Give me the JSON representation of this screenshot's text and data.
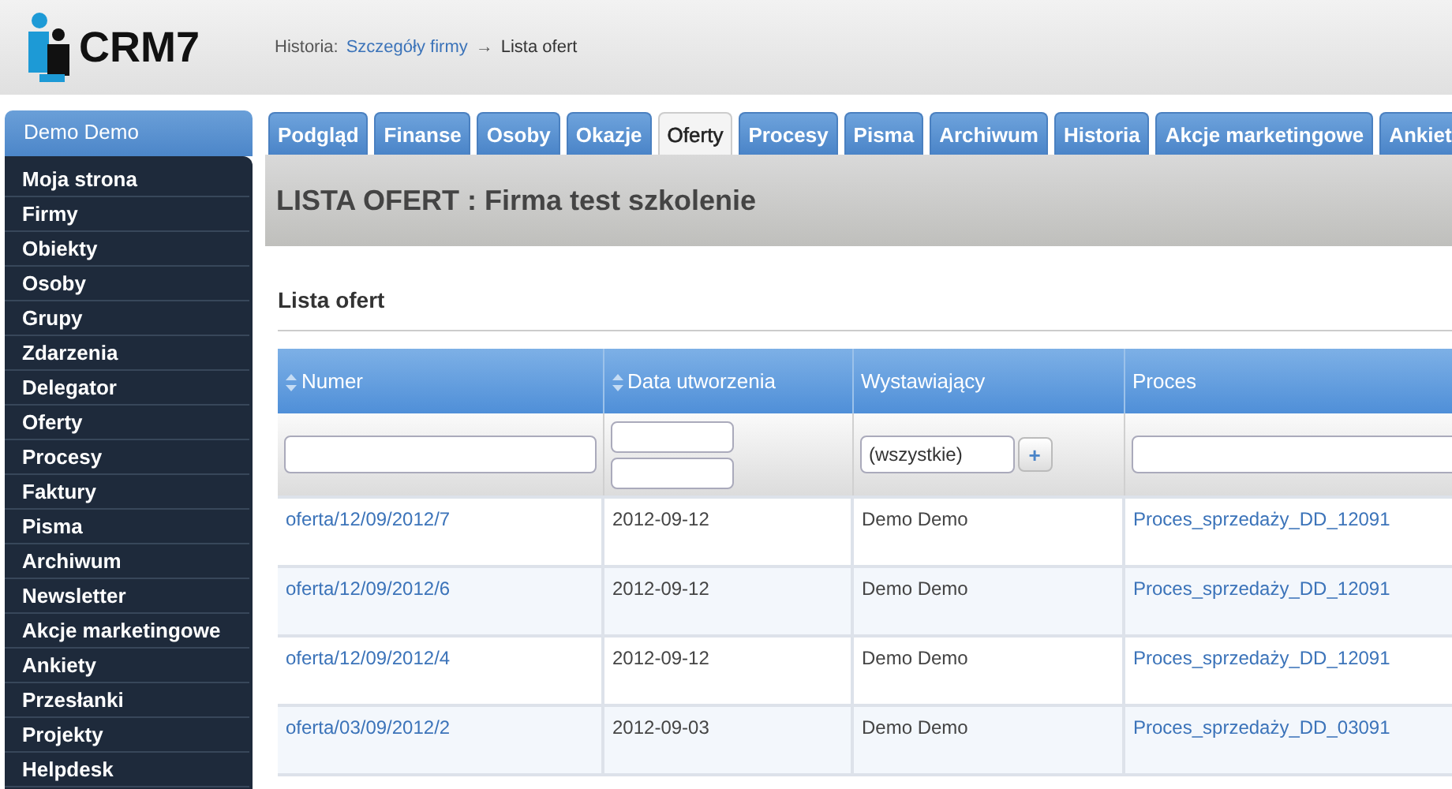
{
  "header": {
    "logo_text": "CRM7",
    "breadcrumb": {
      "label": "Historia:",
      "link": "Szczegóły firmy",
      "arrow": "→",
      "current": "Lista ofert"
    }
  },
  "sidebar": {
    "user": "Demo Demo",
    "items": [
      "Moja strona",
      "Firmy",
      "Obiekty",
      "Osoby",
      "Grupy",
      "Zdarzenia",
      "Delegator",
      "Oferty",
      "Procesy",
      "Faktury",
      "Pisma",
      "Archiwum",
      "Newsletter",
      "Akcje marketingowe",
      "Ankiety",
      "Przesłanki",
      "Projekty",
      "Helpdesk"
    ]
  },
  "tabs": [
    {
      "label": "Podgląd",
      "selected": false
    },
    {
      "label": "Finanse",
      "selected": false
    },
    {
      "label": "Osoby",
      "selected": false
    },
    {
      "label": "Okazje",
      "selected": false
    },
    {
      "label": "Oferty",
      "selected": true
    },
    {
      "label": "Procesy",
      "selected": false
    },
    {
      "label": "Pisma",
      "selected": false
    },
    {
      "label": "Archiwum",
      "selected": false
    },
    {
      "label": "Historia",
      "selected": false
    },
    {
      "label": "Akcje marketingowe",
      "selected": false
    },
    {
      "label": "Ankiet",
      "selected": false
    }
  ],
  "page_title": "LISTA OFERT : Firma test szkolenie",
  "section_title": "Lista ofert",
  "table": {
    "columns": [
      {
        "label": "Numer",
        "sortable": true,
        "filter": {
          "kind": "text"
        }
      },
      {
        "label": "Data utworzenia",
        "sortable": true,
        "filter": {
          "kind": "date_range"
        }
      },
      {
        "label": "Wystawiający",
        "sortable": false,
        "filter": {
          "kind": "select",
          "value": "(wszystkie)",
          "button": "+"
        }
      },
      {
        "label": "Proces",
        "sortable": false,
        "filter": {
          "kind": "text"
        }
      }
    ],
    "rows": [
      [
        "oferta/12/09/2012/7",
        "2012-09-12",
        "Demo Demo",
        "Proces_sprzedaży_DD_12091"
      ],
      [
        "oferta/12/09/2012/6",
        "2012-09-12",
        "Demo Demo",
        "Proces_sprzedaży_DD_12091"
      ],
      [
        "oferta/12/09/2012/4",
        "2012-09-12",
        "Demo Demo",
        "Proces_sprzedaży_DD_12091"
      ],
      [
        "oferta/03/09/2012/2",
        "2012-09-03",
        "Demo Demo",
        "Proces_sprzedaży_DD_03091"
      ]
    ]
  }
}
